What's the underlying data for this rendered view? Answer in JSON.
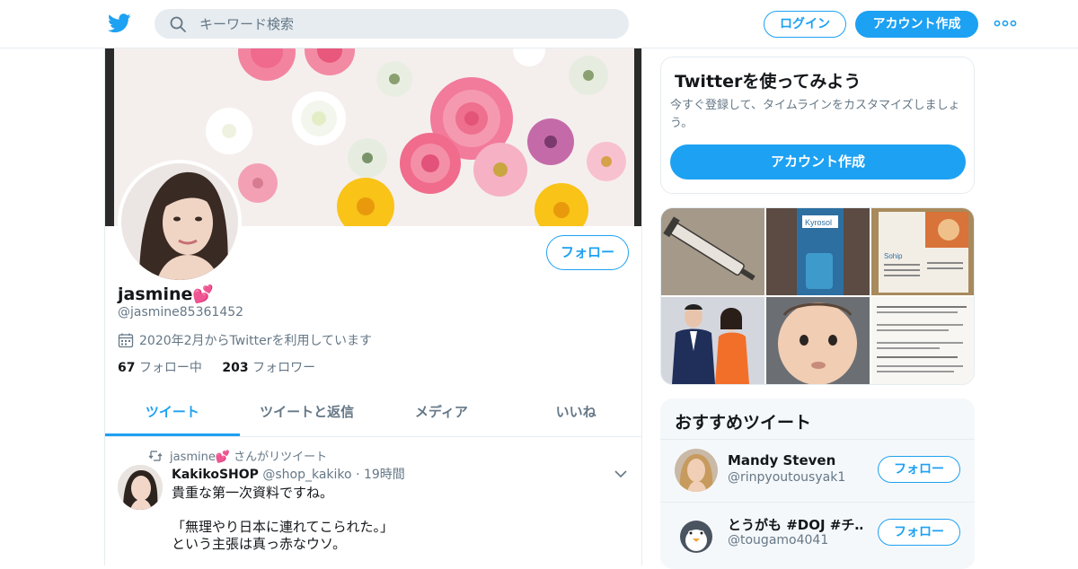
{
  "header": {
    "search_placeholder": "キーワード検索",
    "login_label": "ログイン",
    "signup_label": "アカウント作成",
    "accent_color": "#1da1f2"
  },
  "profile": {
    "display_name": "jasmine💕",
    "handle": "@jasmine85361452",
    "joined": "2020年2月からTwitterを利用しています",
    "following_count": "67",
    "following_label": "フォロー中",
    "followers_count": "203",
    "followers_label": "フォロワー",
    "follow_label": "フォロー"
  },
  "tabs": [
    {
      "label": "ツイート",
      "active": true
    },
    {
      "label": "ツイートと返信",
      "active": false
    },
    {
      "label": "メディア",
      "active": false
    },
    {
      "label": "いいね",
      "active": false
    }
  ],
  "tweet": {
    "retweet_by": "jasmine💕 さんがリツイート",
    "author_name": "KakikoSHOP",
    "author_handle": "@shop_kakiko",
    "time": "19時間",
    "lines": [
      "貴重な第一次資料ですね。",
      "",
      "「無理やり日本に連れてこられた。」",
      "という主張は真っ赤なウソ。"
    ]
  },
  "sidebar": {
    "signup_card": {
      "title": "Twitterを使ってみよう",
      "description": "今すぐ登録して、タイムラインをカスタマイズしましょう。",
      "button": "アカウント作成"
    },
    "media_grid": {
      "cells": [
        {
          "icon": "syringe-photo"
        },
        {
          "icon": "kyrosol-bottle-photo",
          "text": "Kyrosol"
        },
        {
          "icon": "medical-leaflet-photo",
          "text": "Sohip"
        },
        {
          "icon": "couple-photo"
        },
        {
          "icon": "baby-photo"
        },
        {
          "icon": "document-photo"
        }
      ]
    },
    "recommended": {
      "title": "おすすめツイート",
      "follow_label": "フォロー",
      "users": [
        {
          "name": "Mandy Steven",
          "handle": "@rinpyoutousyak1"
        },
        {
          "name": "とうがも #DOJ #チ…",
          "handle": "@tougamo4041"
        }
      ]
    }
  }
}
